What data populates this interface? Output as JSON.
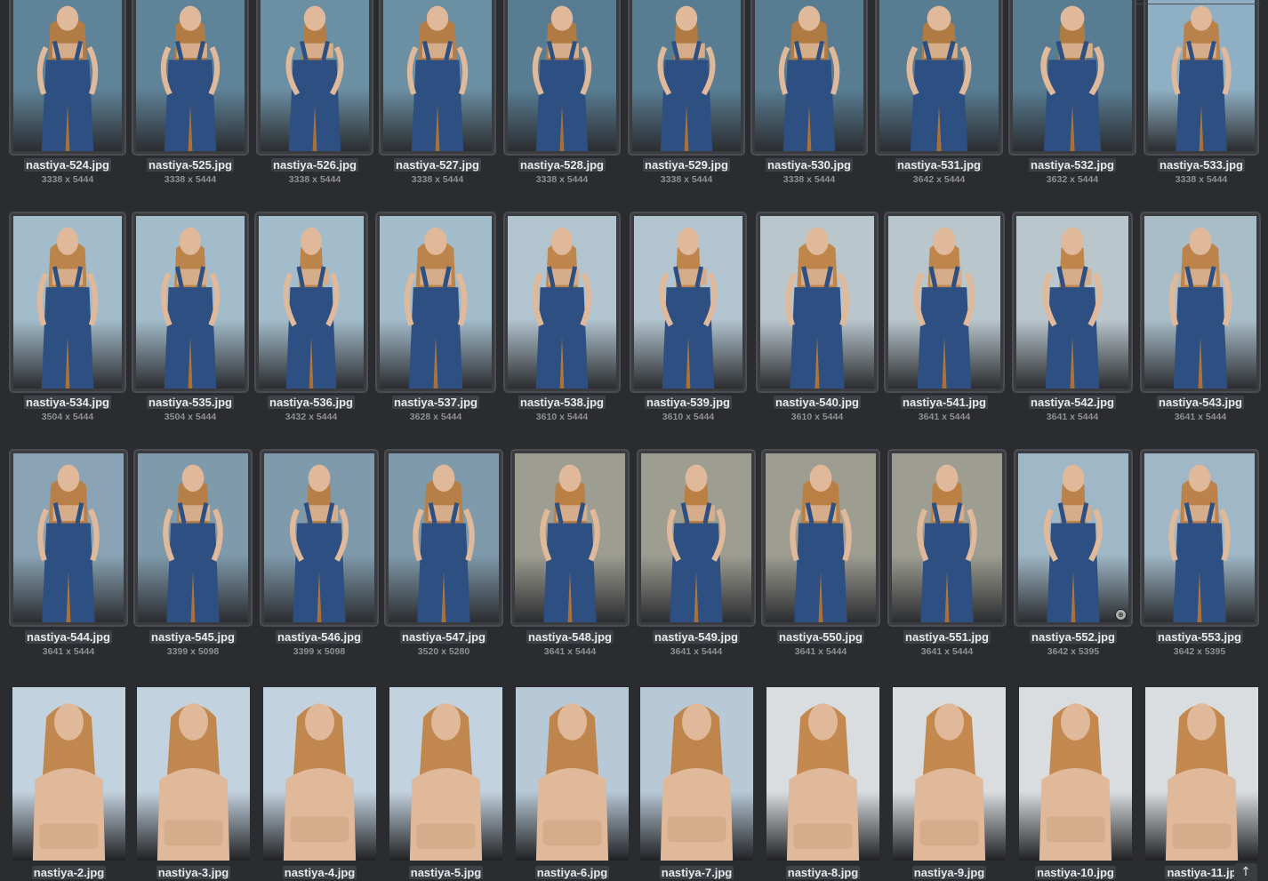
{
  "colors": {
    "background": "#2b2c2f",
    "tile_border": "#4b4d52",
    "filename_text": "#e9e9e9",
    "dims_text": "#8e9095",
    "denim": "#2d4f82",
    "hair": "#c07a35",
    "skin": "#e0b89a",
    "bandeau": "#d6ad8a"
  },
  "gallery": {
    "rows": [
      {
        "items": [
          {
            "filename": "nastiya-524.jpg",
            "dims": "3338 x 5444",
            "bg": "#5f8399",
            "outfit": "overalls"
          },
          {
            "filename": "nastiya-525.jpg",
            "dims": "3338 x 5444",
            "bg": "#5f8399",
            "outfit": "overalls"
          },
          {
            "filename": "nastiya-526.jpg",
            "dims": "3338 x 5444",
            "bg": "#6b8fa3",
            "outfit": "overalls"
          },
          {
            "filename": "nastiya-527.jpg",
            "dims": "3338 x 5444",
            "bg": "#6b8fa3",
            "outfit": "overalls"
          },
          {
            "filename": "nastiya-528.jpg",
            "dims": "3338 x 5444",
            "bg": "#587d93",
            "outfit": "overalls"
          },
          {
            "filename": "nastiya-529.jpg",
            "dims": "3338 x 5444",
            "bg": "#587d93",
            "outfit": "overalls"
          },
          {
            "filename": "nastiya-530.jpg",
            "dims": "3338 x 5444",
            "bg": "#587d93",
            "outfit": "overalls"
          },
          {
            "filename": "nastiya-531.jpg",
            "dims": "3642 x 5444",
            "bg": "#587d93",
            "outfit": "overalls"
          },
          {
            "filename": "nastiya-532.jpg",
            "dims": "3632 x 5444",
            "bg": "#587d93",
            "outfit": "overalls"
          },
          {
            "filename": "nastiya-533.jpg",
            "dims": "3338 x 5444",
            "bg": "#8fb0c4",
            "outfit": "overalls"
          }
        ]
      },
      {
        "items": [
          {
            "filename": "nastiya-534.jpg",
            "dims": "3504 x 5444",
            "bg": "#a3bccb",
            "outfit": "overalls"
          },
          {
            "filename": "nastiya-535.jpg",
            "dims": "3504 x 5444",
            "bg": "#a3bccb",
            "outfit": "overalls"
          },
          {
            "filename": "nastiya-536.jpg",
            "dims": "3432 x 5444",
            "bg": "#a3bccb",
            "outfit": "overalls"
          },
          {
            "filename": "nastiya-537.jpg",
            "dims": "3628 x 5444",
            "bg": "#a3bccb",
            "outfit": "overalls"
          },
          {
            "filename": "nastiya-538.jpg",
            "dims": "3610 x 5444",
            "bg": "#b2c4cf",
            "outfit": "overalls"
          },
          {
            "filename": "nastiya-539.jpg",
            "dims": "3610 x 5444",
            "bg": "#b2c4cf",
            "outfit": "overalls"
          },
          {
            "filename": "nastiya-540.jpg",
            "dims": "3610 x 5444",
            "bg": "#b9c6cc",
            "outfit": "overalls"
          },
          {
            "filename": "nastiya-541.jpg",
            "dims": "3641 x 5444",
            "bg": "#b9c6cc",
            "outfit": "overalls"
          },
          {
            "filename": "nastiya-542.jpg",
            "dims": "3641 x 5444",
            "bg": "#b9c6cc",
            "outfit": "overalls"
          },
          {
            "filename": "nastiya-543.jpg",
            "dims": "3641 x 5444",
            "bg": "#a9bdc9",
            "outfit": "overalls"
          }
        ]
      },
      {
        "items": [
          {
            "filename": "nastiya-544.jpg",
            "dims": "3641 x 5444",
            "bg": "#8aa4b5",
            "outfit": "overalls"
          },
          {
            "filename": "nastiya-545.jpg",
            "dims": "3399 x 5098",
            "bg": "#7f9aab",
            "outfit": "overalls"
          },
          {
            "filename": "nastiya-546.jpg",
            "dims": "3399 x 5098",
            "bg": "#7f9aab",
            "outfit": "overalls"
          },
          {
            "filename": "nastiya-547.jpg",
            "dims": "3520 x 5280",
            "bg": "#7f9aab",
            "outfit": "overalls"
          },
          {
            "filename": "nastiya-548.jpg",
            "dims": "3641 x 5444",
            "bg": "#9d9d92",
            "outfit": "overalls"
          },
          {
            "filename": "nastiya-549.jpg",
            "dims": "3641 x 5444",
            "bg": "#9d9d92",
            "outfit": "overalls"
          },
          {
            "filename": "nastiya-550.jpg",
            "dims": "3641 x 5444",
            "bg": "#9d9d92",
            "outfit": "overalls"
          },
          {
            "filename": "nastiya-551.jpg",
            "dims": "3641 x 5444",
            "bg": "#9d9d92",
            "outfit": "overalls"
          },
          {
            "filename": "nastiya-552.jpg",
            "dims": "3642 x 5395",
            "bg": "#9fb7c6",
            "outfit": "overalls"
          },
          {
            "filename": "nastiya-553.jpg",
            "dims": "3642 x 5395",
            "bg": "#9fb7c6",
            "outfit": "overalls"
          }
        ]
      },
      {
        "items": [
          {
            "filename": "nastiya-2.jpg",
            "dims": "",
            "bg": "#c3d2df",
            "outfit": "bandeau"
          },
          {
            "filename": "nastiya-3.jpg",
            "dims": "",
            "bg": "#c3d2df",
            "outfit": "bandeau"
          },
          {
            "filename": "nastiya-4.jpg",
            "dims": "",
            "bg": "#c3d2df",
            "outfit": "bandeau"
          },
          {
            "filename": "nastiya-5.jpg",
            "dims": "",
            "bg": "#c3d2df",
            "outfit": "bandeau"
          },
          {
            "filename": "nastiya-6.jpg",
            "dims": "",
            "bg": "#b7c8d6",
            "outfit": "bandeau"
          },
          {
            "filename": "nastiya-7.jpg",
            "dims": "",
            "bg": "#b7c8d6",
            "outfit": "bandeau"
          },
          {
            "filename": "nastiya-8.jpg",
            "dims": "",
            "bg": "#d9dde0",
            "outfit": "bandeau"
          },
          {
            "filename": "nastiya-9.jpg",
            "dims": "",
            "bg": "#d9dde0",
            "outfit": "bandeau"
          },
          {
            "filename": "nastiya-10.jpg",
            "dims": "",
            "bg": "#d9dde0",
            "outfit": "bandeau"
          },
          {
            "filename": "nastiya-11.jp",
            "dims": "",
            "bg": "#d9dde0",
            "outfit": "bandeau"
          }
        ]
      }
    ]
  },
  "scroll_top": {
    "icon": "arrow-up-icon",
    "glyph": "↑"
  }
}
